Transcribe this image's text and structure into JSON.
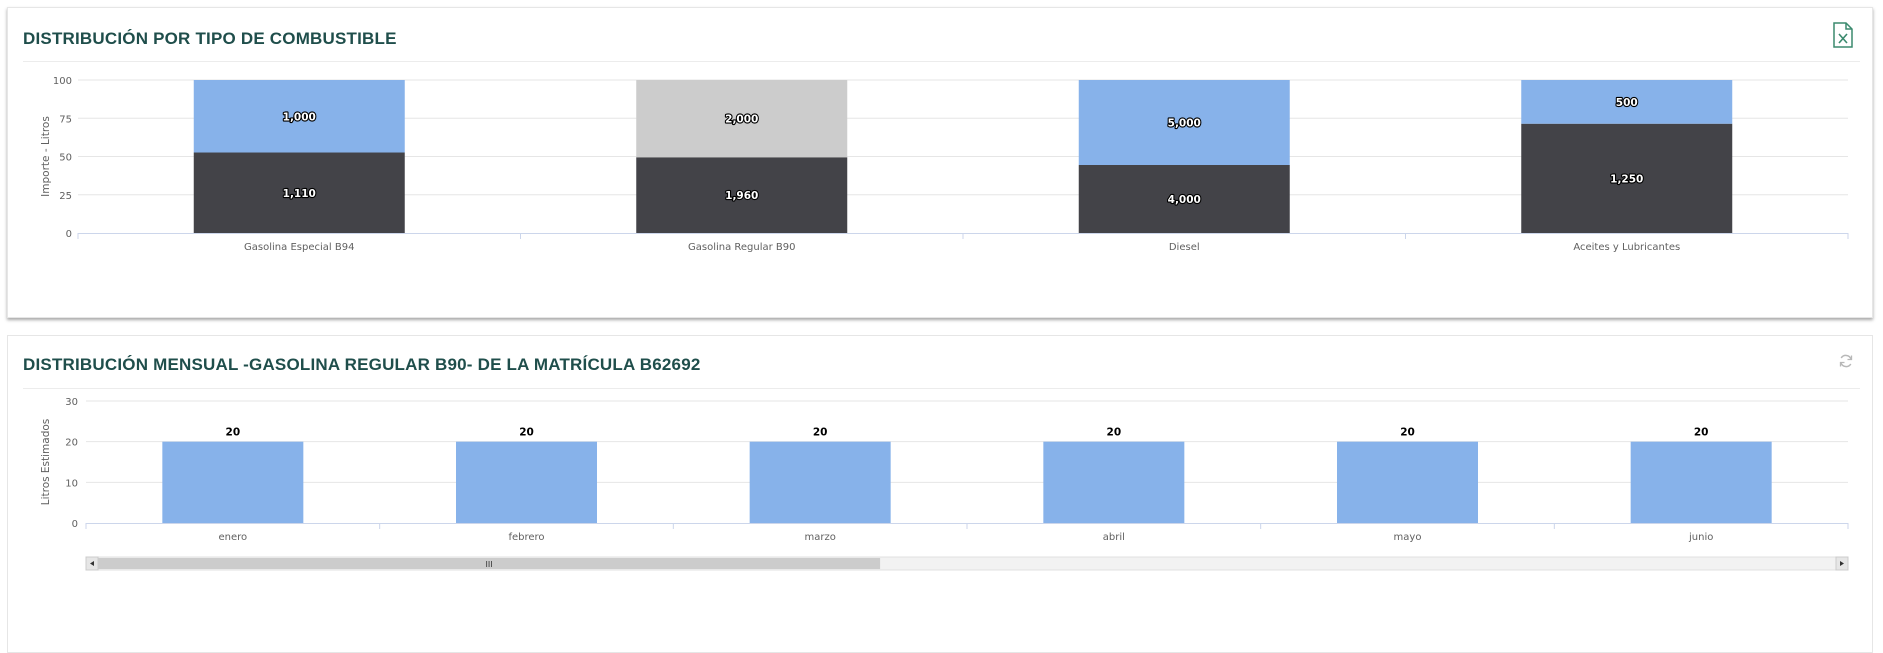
{
  "panel1": {
    "title": "DISTRIBUCIÓN POR TIPO DE COMBUSTIBLE",
    "export_icon": "excel-export-icon"
  },
  "panel2": {
    "title": "DISTRIBUCIÓN MENSUAL -GASOLINA REGULAR B90- DE LA MATRÍCULA B62692",
    "refresh_icon": "refresh-icon"
  },
  "colors": {
    "title": "#1f4e4b",
    "blue": "#87b2ea",
    "dark": "#434348",
    "gray": "#cccccc"
  },
  "chart_data": [
    {
      "type": "bar",
      "stacked": true,
      "percent": true,
      "title": "",
      "xlabel": "",
      "ylabel": "Importe - Litros",
      "ylim": [
        0,
        100
      ],
      "yticks": [
        "0",
        "25",
        "50",
        "75",
        "100"
      ],
      "categories": [
        "Gasolina Especial B94",
        "Gasolina Regular B90",
        "Diesel",
        "Aceites y Lubricantes"
      ],
      "series": [
        {
          "values": [
            1110,
            1960,
            4000,
            1250
          ],
          "labels": [
            "1,110",
            "1,960",
            "4,000",
            "1,250"
          ],
          "colors": [
            "#434348",
            "#434348",
            "#434348",
            "#434348"
          ]
        },
        {
          "values": [
            1000,
            2000,
            5000,
            500
          ],
          "labels": [
            "1,000",
            "2,000",
            "5,000",
            "500"
          ],
          "colors": [
            "#87b2ea",
            "#cccccc",
            "#87b2ea",
            "#87b2ea"
          ]
        }
      ],
      "grid": true,
      "legend": "none"
    },
    {
      "type": "bar",
      "title": "",
      "xlabel": "",
      "ylabel": "Litros Estimados",
      "ylim": [
        0,
        30
      ],
      "yticks": [
        "0",
        "10",
        "20",
        "30"
      ],
      "categories": [
        "enero",
        "febrero",
        "marzo",
        "abril",
        "mayo",
        "junio"
      ],
      "values": [
        20,
        20,
        20,
        20,
        20,
        20
      ],
      "labels": [
        "20",
        "20",
        "20",
        "20",
        "20",
        "20"
      ],
      "grid": true,
      "legend": "none",
      "scrollbar": {
        "visible_fraction": 0.45,
        "thumb_glyph": "III"
      }
    }
  ]
}
